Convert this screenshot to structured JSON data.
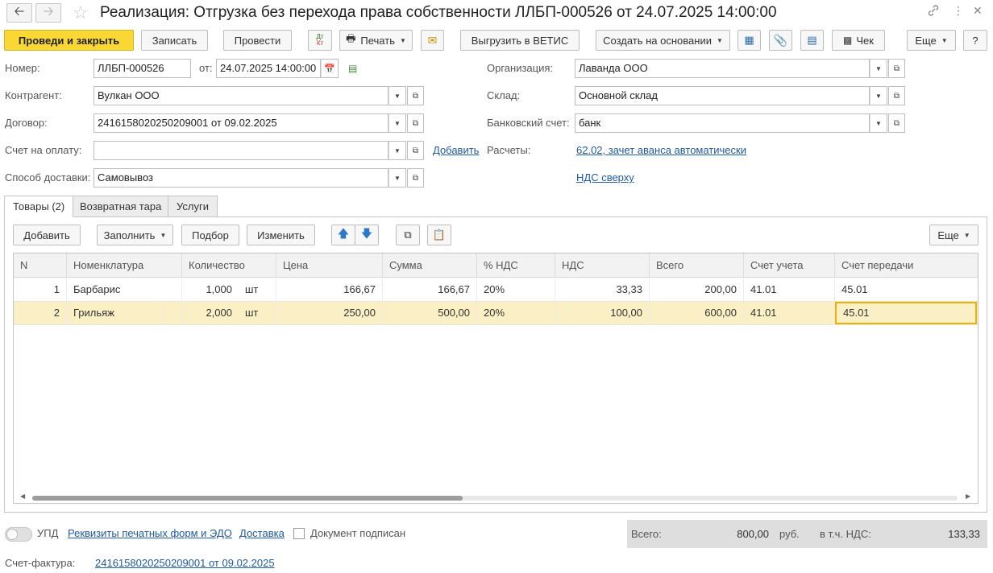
{
  "window": {
    "title": "Реализация: Отгрузка без перехода права собственности ЛЛБП-000526 от 24.07.2025 14:00:00"
  },
  "toolbar": {
    "post_and_close": "Проведи и закрыть",
    "save": "Записать",
    "post": "Провести",
    "print": "Печать",
    "export_vetis": "Выгрузить в ВЕТИС",
    "create_based_on": "Создать на основании",
    "receipt": "Чек",
    "more": "Еще",
    "help": "?"
  },
  "header": {
    "number_label": "Номер:",
    "number_value": "ЛЛБП-000526",
    "date_label": "от:",
    "date_value": "24.07.2025 14:00:00",
    "counterparty_label": "Контрагент:",
    "counterparty_value": "Вулкан ООО",
    "contract_label": "Договор:",
    "contract_value": "2416158020250209001 от 09.02.2025",
    "invoice_label": "Счет на оплату:",
    "invoice_value": "",
    "add_link": "Добавить",
    "delivery_label": "Способ доставки:",
    "delivery_value": "Самовывоз",
    "org_label": "Организация:",
    "org_value": "Лаванда ООО",
    "warehouse_label": "Склад:",
    "warehouse_value": "Основной склад",
    "bank_label": "Банковский счет:",
    "bank_value": "банк",
    "settlements_label": "Расчеты:",
    "settlements_link": "62.02, зачет аванса автоматически",
    "vat_link": "НДС сверху"
  },
  "tabs": [
    {
      "label": "Товары (2)"
    },
    {
      "label": "Возвратная тара"
    },
    {
      "label": "Услуги"
    }
  ],
  "table_toolbar": {
    "add": "Добавить",
    "fill": "Заполнить",
    "pick": "Подбор",
    "change": "Изменить",
    "more": "Еще"
  },
  "table": {
    "columns": [
      "N",
      "Номенклатура",
      "Количество",
      "Цена",
      "Сумма",
      "% НДС",
      "НДС",
      "Всего",
      "Счет учета",
      "Счет передачи"
    ],
    "rows": [
      {
        "n": "1",
        "item": "Барбарис",
        "qty": "1,000",
        "unit": "шт",
        "price": "166,67",
        "sum": "166,67",
        "vat_rate": "20%",
        "vat": "33,33",
        "total": "200,00",
        "account": "41.01",
        "transfer_account": "45.01"
      },
      {
        "n": "2",
        "item": "Грильяж",
        "qty": "2,000",
        "unit": "шт",
        "price": "250,00",
        "sum": "500,00",
        "vat_rate": "20%",
        "vat": "100,00",
        "total": "600,00",
        "account": "41.01",
        "transfer_account": "45.01"
      }
    ]
  },
  "footer": {
    "upd_label": "УПД",
    "print_requisites_link": "Реквизиты печатных форм и ЭДО",
    "delivery_link": "Доставка",
    "signed_label": "Документ подписан",
    "total_label": "Всего:",
    "total_value": "800,00",
    "currency": "руб.",
    "vat_incl_label": "в т.ч. НДС:",
    "vat_incl_value": "133,33",
    "invoice_label": "Счет-фактура:",
    "invoice_link": "2416158020250209001 от 09.02.2025"
  },
  "colors": {
    "primary_button": "#f9d734",
    "link": "#1f5a9e",
    "selected_row": "#fbf0c5"
  }
}
